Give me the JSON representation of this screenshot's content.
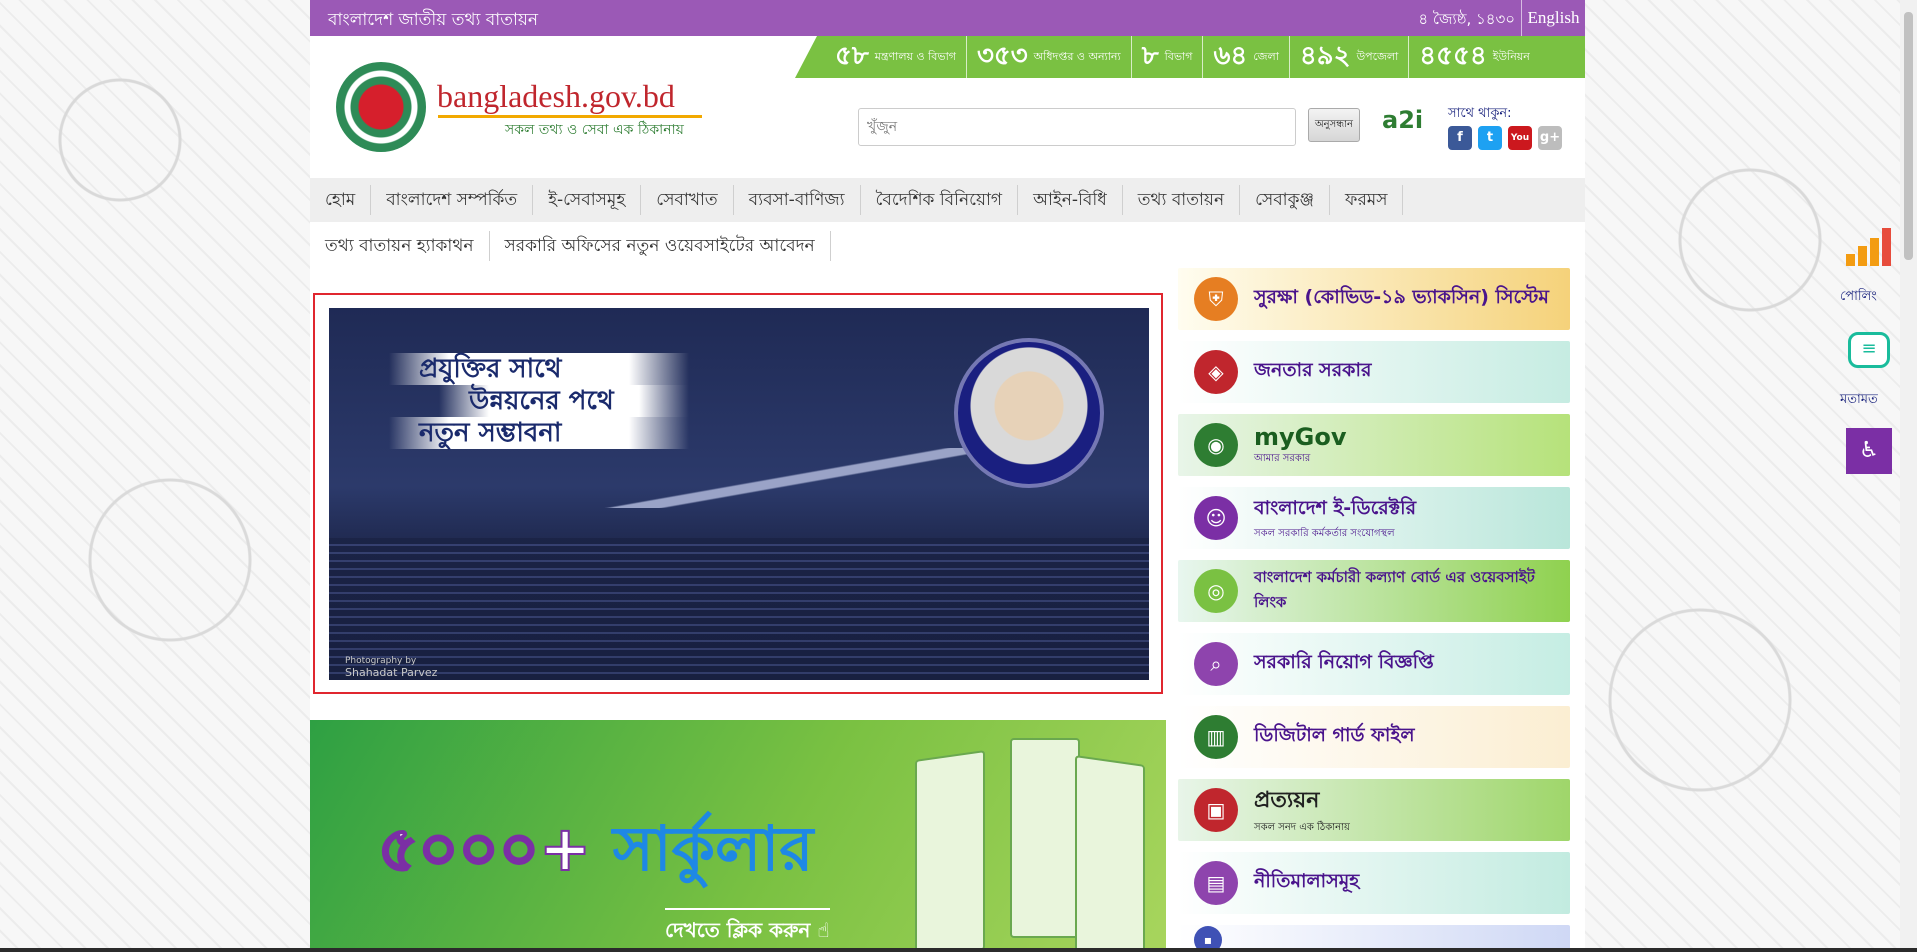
{
  "topbar": {
    "portal_name": "বাংলাদেশ জাতীয় তথ্য বাতায়ন",
    "date": "৪ জ্যৈষ্ঠ, ১৪৩০",
    "language_toggle": "English"
  },
  "stats": [
    {
      "num": "৫৮",
      "label": "মন্ত্রণালয় ও বিভাগ"
    },
    {
      "num": "৩৫৩",
      "label": "অধিদপ্তর ও অন্যান্য"
    },
    {
      "num": "৮",
      "label": "বিভাগ"
    },
    {
      "num": "৬৪",
      "label": "জেলা"
    },
    {
      "num": "৪৯২",
      "label": "উপজেলা"
    },
    {
      "num": "৪৫৫৪",
      "label": "ইউনিয়ন"
    }
  ],
  "header": {
    "site_name": "bangladesh.gov.bd",
    "tagline": "সকল তথ্য ও সেবা এক ঠিকানায়",
    "search_placeholder": "খুঁজুন",
    "search_button": "অনুসন্ধান",
    "a2i_logo": "a2i",
    "follow_label": "সাথে থাকুন:",
    "social_icons": [
      "facebook-icon",
      "twitter-icon",
      "youtube-icon",
      "google-plus-icon"
    ]
  },
  "nav": {
    "row1": [
      "হোম",
      "বাংলাদেশ সম্পর্কিত",
      "ই-সেবাসমূহ",
      "সেবাখাত",
      "ব্যবসা-বাণিজ্য",
      "বৈদেশিক বিনিয়োগ",
      "আইন-বিধি",
      "তথ্য বাতায়ন",
      "সেবাকুঞ্জ",
      "ফরমস"
    ],
    "row2": [
      "তথ্য বাতায়ন হ্যাকাথন",
      "সরকারি অফিসের নতুন ওয়েবসাইটের আবেদন"
    ]
  },
  "slider": {
    "line1": "প্রযুক্তির সাথে",
    "line2": "উন্নয়নের পথে",
    "line3": "নতুন সম্ভাবনা",
    "credit_label": "Photography by",
    "credit_name": "Shahadat Parvez"
  },
  "banner": {
    "number": "৫০০০+",
    "word": "সার্কুলার",
    "cta": "দেখতে ক্লিক করুন"
  },
  "cards": [
    {
      "title": "সুরক্ষা (কোভিড-১৯ ভ্যাকসিন) সিস্টেম",
      "sub": "",
      "icon": "shield-icon",
      "color": "#e67e22"
    },
    {
      "title": "জনতার সরকার",
      "sub": "",
      "icon": "map-icon",
      "color": "#c0262d"
    },
    {
      "title": "myGov",
      "sub": "আমার সরকার",
      "icon": "mygov-icon",
      "color": "#2e7d32"
    },
    {
      "title": "বাংলাদেশ ই-ডিরেক্টরি",
      "sub": "সকল সরকারি কর্মকর্তার সংযোগস্থল",
      "icon": "user-icon",
      "color": "#7b2fa5"
    },
    {
      "title": "বাংলাদেশ কর্মচারী কল্যাণ বোর্ড এর ওয়েবসাইট লিংক",
      "sub": "",
      "icon": "globe-icon",
      "color": "#7ac142"
    },
    {
      "title": "সরকারি নিয়োগ বিজ্ঞপ্তি",
      "sub": "",
      "icon": "search-person-icon",
      "color": "#8e44ad"
    },
    {
      "title": "ডিজিটাল গার্ড ফাইল",
      "sub": "",
      "icon": "binder-icon",
      "color": "#2e7d32"
    },
    {
      "title": "প্রত্যয়ন",
      "sub": "সকল সনদ এক ঠিকানায়",
      "icon": "certificate-icon",
      "color": "#c0262d"
    },
    {
      "title": "নীতিমালাসমূহ",
      "sub": "",
      "icon": "document-hand-icon",
      "color": "#8e44ad"
    },
    {
      "title": "",
      "sub": "",
      "icon": "partial-card-icon",
      "color": "#3f51b5"
    }
  ],
  "widgets": {
    "poll_label": "পোলিং",
    "feedback_label": "মতামত",
    "accessibility_icon": "accessibility-icon"
  }
}
